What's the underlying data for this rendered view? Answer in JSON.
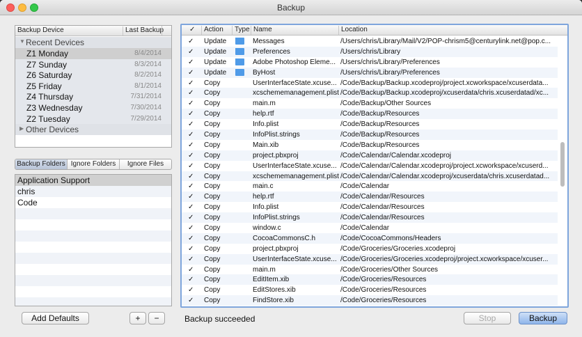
{
  "window": {
    "title": "Backup"
  },
  "devices": {
    "col_device": "Backup Device",
    "col_last": "Last Backup",
    "group_recent": "Recent Devices",
    "group_other": "Other Devices",
    "items": [
      {
        "name": "Z1 Monday",
        "date": "8/4/2014"
      },
      {
        "name": "Z7 Sunday",
        "date": "8/3/2014"
      },
      {
        "name": "Z6 Saturday",
        "date": "8/2/2014"
      },
      {
        "name": "Z5 Friday",
        "date": "8/1/2014"
      },
      {
        "name": "Z4 Thursday",
        "date": "7/31/2014"
      },
      {
        "name": "Z3 Wednesday",
        "date": "7/30/2014"
      },
      {
        "name": "Z2 Tuesday",
        "date": "7/29/2014"
      }
    ]
  },
  "tabs": [
    {
      "label": "Backup Folders"
    },
    {
      "label": "Ignore Folders"
    },
    {
      "label": "Ignore Files"
    }
  ],
  "folders": [
    "Application Support",
    "chris",
    "Code"
  ],
  "buttons": {
    "add_defaults": "Add Defaults",
    "plus": "+",
    "minus": "−",
    "stop": "Stop",
    "backup": "Backup"
  },
  "status": "Backup succeeded",
  "files": {
    "col_check": "✓",
    "col_action": "Action",
    "col_type": "Type",
    "col_name": "Name",
    "col_location": "Location",
    "rows": [
      {
        "check": "✓",
        "action": "Update",
        "folder": true,
        "name": "Messages",
        "location": "/Users/chris/Library/Mail/V2/POP-chrism5@centurylink.net@pop.c..."
      },
      {
        "check": "✓",
        "action": "Update",
        "folder": true,
        "name": "Preferences",
        "location": "/Users/chris/Library"
      },
      {
        "check": "✓",
        "action": "Update",
        "folder": true,
        "name": "Adobe Photoshop Eleme...",
        "location": "/Users/chris/Library/Preferences"
      },
      {
        "check": "✓",
        "action": "Update",
        "folder": true,
        "name": "ByHost",
        "location": "/Users/chris/Library/Preferences"
      },
      {
        "check": "✓",
        "action": "Copy",
        "folder": false,
        "name": "UserInterfaceState.xcuse...",
        "location": "/Code/Backup/Backup.xcodeproj/project.xcworkspace/xcuserdata..."
      },
      {
        "check": "✓",
        "action": "Copy",
        "folder": false,
        "name": "xcschememanagement.plist",
        "location": "/Code/Backup/Backup.xcodeproj/xcuserdata/chris.xcuserdatad/xc..."
      },
      {
        "check": "✓",
        "action": "Copy",
        "folder": false,
        "name": "main.m",
        "location": "/Code/Backup/Other Sources"
      },
      {
        "check": "✓",
        "action": "Copy",
        "folder": false,
        "name": "help.rtf",
        "location": "/Code/Backup/Resources"
      },
      {
        "check": "✓",
        "action": "Copy",
        "folder": false,
        "name": "Info.plist",
        "location": "/Code/Backup/Resources"
      },
      {
        "check": "✓",
        "action": "Copy",
        "folder": false,
        "name": "InfoPlist.strings",
        "location": "/Code/Backup/Resources"
      },
      {
        "check": "✓",
        "action": "Copy",
        "folder": false,
        "name": "Main.xib",
        "location": "/Code/Backup/Resources"
      },
      {
        "check": "✓",
        "action": "Copy",
        "folder": false,
        "name": "project.pbxproj",
        "location": "/Code/Calendar/Calendar.xcodeproj"
      },
      {
        "check": "✓",
        "action": "Copy",
        "folder": false,
        "name": "UserInterfaceState.xcuse...",
        "location": "/Code/Calendar/Calendar.xcodeproj/project.xcworkspace/xcuserd..."
      },
      {
        "check": "✓",
        "action": "Copy",
        "folder": false,
        "name": "xcschememanagement.plist",
        "location": "/Code/Calendar/Calendar.xcodeproj/xcuserdata/chris.xcuserdatad..."
      },
      {
        "check": "✓",
        "action": "Copy",
        "folder": false,
        "name": "main.c",
        "location": "/Code/Calendar"
      },
      {
        "check": "✓",
        "action": "Copy",
        "folder": false,
        "name": "help.rtf",
        "location": "/Code/Calendar/Resources"
      },
      {
        "check": "✓",
        "action": "Copy",
        "folder": false,
        "name": "Info.plist",
        "location": "/Code/Calendar/Resources"
      },
      {
        "check": "✓",
        "action": "Copy",
        "folder": false,
        "name": "InfoPlist.strings",
        "location": "/Code/Calendar/Resources"
      },
      {
        "check": "✓",
        "action": "Copy",
        "folder": false,
        "name": "window.c",
        "location": "/Code/Calendar"
      },
      {
        "check": "✓",
        "action": "Copy",
        "folder": false,
        "name": "CocoaCommonsC.h",
        "location": "/Code/CocoaCommons/Headers"
      },
      {
        "check": "✓",
        "action": "Copy",
        "folder": false,
        "name": "project.pbxproj",
        "location": "/Code/Groceries/Groceries.xcodeproj"
      },
      {
        "check": "✓",
        "action": "Copy",
        "folder": false,
        "name": "UserInterfaceState.xcuse...",
        "location": "/Code/Groceries/Groceries.xcodeproj/project.xcworkspace/xcuser..."
      },
      {
        "check": "✓",
        "action": "Copy",
        "folder": false,
        "name": "main.m",
        "location": "/Code/Groceries/Other Sources"
      },
      {
        "check": "✓",
        "action": "Copy",
        "folder": false,
        "name": "EditItem.xib",
        "location": "/Code/Groceries/Resources"
      },
      {
        "check": "✓",
        "action": "Copy",
        "folder": false,
        "name": "EditStores.xib",
        "location": "/Code/Groceries/Resources"
      },
      {
        "check": "✓",
        "action": "Copy",
        "folder": false,
        "name": "FindStore.xib",
        "location": "/Code/Groceries/Resources"
      }
    ]
  },
  "icons": {
    "folder": "folder-icon",
    "triangle_open": "▼",
    "triangle_closed": "▶"
  }
}
